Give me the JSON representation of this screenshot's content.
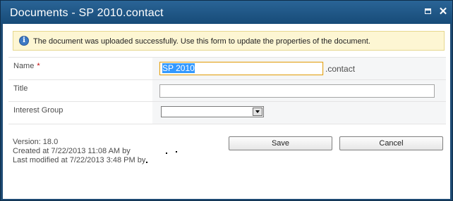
{
  "window": {
    "title": "Documents - SP 2010.contact",
    "maximize_icon": "maximize-icon",
    "close_icon": "close-icon",
    "close_glyph": "✕",
    "titlebar_color": "#1d4a73"
  },
  "notice": {
    "icon": "info-icon",
    "icon_glyph": "i",
    "text": "The document was uploaded successfully. Use this form to update the properties of the document.",
    "background": "#fdf6d3"
  },
  "form": {
    "name": {
      "label": "Name",
      "required_marker": "*",
      "value": "SP 2010",
      "extension": ".contact"
    },
    "title": {
      "label": "Title",
      "value": ""
    },
    "interest_group": {
      "label": "Interest Group",
      "selected": ""
    }
  },
  "meta": {
    "version": "Version: 18.0",
    "created": "Created at 7/22/2013 11:08 AM  by",
    "modified": "Last modified at 7/22/2013 3:48 PM  by"
  },
  "buttons": {
    "save": "Save",
    "cancel": "Cancel"
  }
}
